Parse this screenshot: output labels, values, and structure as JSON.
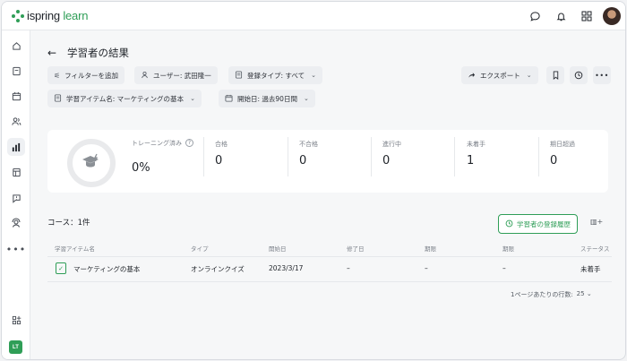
{
  "app": {
    "logo_prefix": "ispring",
    "logo_suffix": "learn",
    "brand_color": "#2f9e57"
  },
  "topbar_icons": [
    "chat-icon",
    "bell-icon",
    "apps-grid-icon",
    "user-avatar"
  ],
  "sidebar": {
    "items": [
      "home-icon",
      "courses-icon",
      "calendar-icon",
      "users-icon",
      "reports-icon",
      "catalog-icon",
      "feedback-icon",
      "support-icon",
      "more-icon"
    ],
    "active": "reports-icon",
    "bottom_icon": "integrations-icon",
    "badge": "LT"
  },
  "header": {
    "title": "学習者の結果"
  },
  "filters": {
    "add": "フィルターを追加",
    "user": "ユーザー: 武田隆一",
    "enroll_type": "登録タイプ: すべて",
    "item": "学習アイテム名: マーケティングの基本",
    "start_date": "開始日: 過去90日間"
  },
  "toolbar": {
    "export": "エクスポート"
  },
  "summary": {
    "training_label": "トレーニング済み",
    "training_value": "0%",
    "stats": [
      {
        "label": "合格",
        "value": "0"
      },
      {
        "label": "不合格",
        "value": "0"
      },
      {
        "label": "進行中",
        "value": "0"
      },
      {
        "label": "未着手",
        "value": "1"
      },
      {
        "label": "期日超過",
        "value": "0"
      }
    ]
  },
  "courses": {
    "label": "コース：",
    "count": "1件"
  },
  "history_button": "学習者の登録履歴",
  "columns_button": "▥+",
  "table": {
    "headers": [
      "学習アイテム名",
      "タイプ",
      "開始日",
      "修了日",
      "期限",
      "期限",
      "ステータス"
    ],
    "rows": [
      {
        "name": "マーケティングの基本",
        "type": "オンラインクイズ",
        "start": "2023/3/17",
        "end": "–",
        "deadline1": "–",
        "deadline2": "–",
        "status": "未着手"
      }
    ]
  },
  "pagination": {
    "label": "1ページあたりの行数:",
    "value": "25"
  }
}
